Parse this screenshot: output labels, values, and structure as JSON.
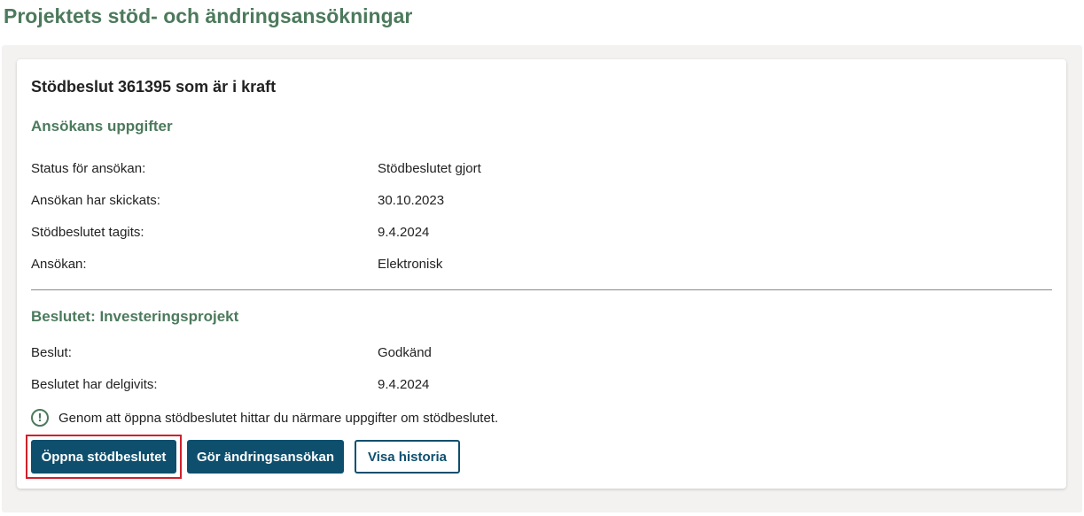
{
  "page": {
    "title": "Projektets stöd- och ändringsansökningar"
  },
  "card": {
    "title": "Stödbeslut 361395 som är i kraft",
    "application_section": {
      "heading": "Ansökans uppgifter",
      "rows": [
        {
          "label": "Status för ansökan:",
          "value": "Stödbeslutet gjort"
        },
        {
          "label": "Ansökan har skickats:",
          "value": "30.10.2023"
        },
        {
          "label": "Stödbeslutet tagits:",
          "value": "9.4.2024"
        },
        {
          "label": "Ansökan:",
          "value": "Elektronisk"
        }
      ]
    },
    "decision_section": {
      "heading": "Beslutet: Investeringsprojekt",
      "rows": [
        {
          "label": "Beslut:",
          "value": "Godkänd"
        },
        {
          "label": "Beslutet har delgivits:",
          "value": "9.4.2024"
        }
      ]
    },
    "info_text": "Genom att öppna stödbeslutet hittar du närmare uppgifter om stödbeslutet.",
    "info_icon": "!",
    "buttons": {
      "open_decision": "Öppna stödbeslutet",
      "make_change": "Gör ändringsansökan",
      "show_history": "Visa historia"
    }
  },
  "colors": {
    "heading_green": "#4c7a5c",
    "button_blue": "#0e4f6e",
    "highlight_red": "#d0202a",
    "panel_bg": "#f3f2f1"
  }
}
